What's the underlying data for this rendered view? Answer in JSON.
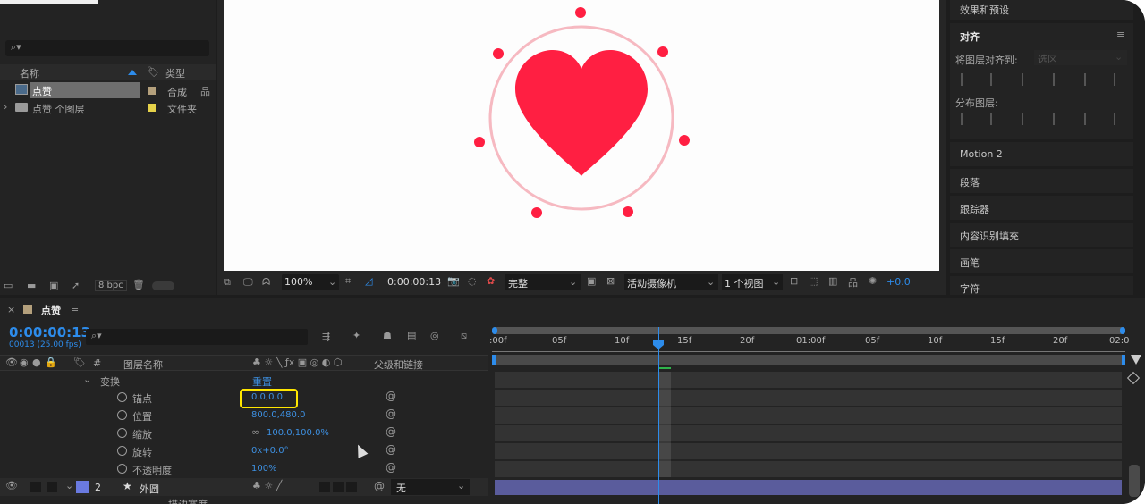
{
  "project": {
    "search_placeholder": "",
    "col_name": "名称",
    "col_type": "类型",
    "items": [
      {
        "name": "点赞",
        "type": "合成"
      },
      {
        "name": "点赞 个图层",
        "type": "文件夹"
      }
    ],
    "bpc": "8 bpc"
  },
  "viewer": {
    "zoom": "100%",
    "timecode": "0:00:00:13",
    "quality": "完整",
    "camera": "活动摄像机",
    "views": "1 个视图",
    "exposure": "+0.0"
  },
  "right_panel": {
    "effects_presets": "效果和预设",
    "align_title": "对齐",
    "align_to_label": "将图层对齐到:",
    "align_to_value": "选区",
    "distribute_label": "分布图层:",
    "sections": [
      "Motion 2",
      "段落",
      "跟踪器",
      "内容识别填充",
      "画笔",
      "字符"
    ]
  },
  "timeline": {
    "comp_name": "点赞",
    "timecode": "0:00:00:13",
    "frame_info": "00013 (25.00 fps)",
    "col_layer_name": "图层名称",
    "col_parent": "父级和链接",
    "col_num": "#",
    "ruler": [
      ":00f",
      "05f",
      "10f",
      "15f",
      "20f",
      "01:00f",
      "05f",
      "10f",
      "15f",
      "20f",
      "02:0"
    ],
    "transform_label": "变换",
    "reset_label": "重置",
    "properties": [
      {
        "name": "锚点",
        "value": "0.0,0.0"
      },
      {
        "name": "位置",
        "value": "800.0,480.0"
      },
      {
        "name": "缩放",
        "value": "100.0,100.0%"
      },
      {
        "name": "旋转",
        "value": "0x+0.0°"
      },
      {
        "name": "不透明度",
        "value": "100%"
      }
    ],
    "layer2": {
      "num": "2",
      "name": "外圆",
      "parent": "无"
    },
    "partial_row": "描边宽度"
  },
  "colors": {
    "accent": "#2d8ceb",
    "heart": "#ff1f42",
    "ring": "#f6b9c1",
    "highlight": "#ffe600",
    "layer_bar": "#5a5c9c"
  }
}
